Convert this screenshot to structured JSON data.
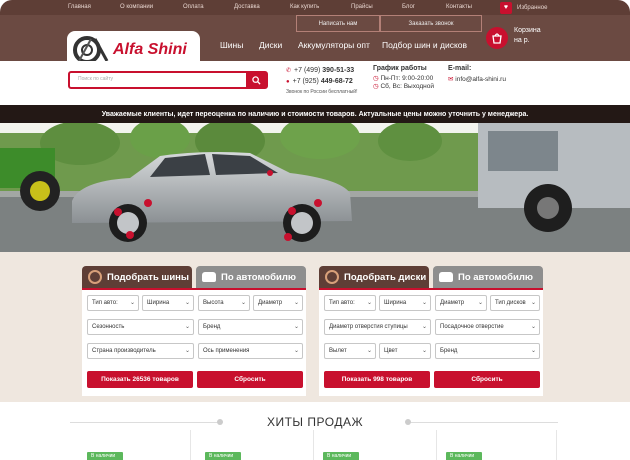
{
  "topnav": {
    "items": [
      "Главная",
      "О компании",
      "Оплата",
      "Доставка",
      "Как купить",
      "Прайсы",
      "Блог",
      "Контакты"
    ],
    "favorites": "Избранное"
  },
  "header": {
    "callback_label": "Написать нам",
    "order_call_label": "Заказать звонок",
    "logo_text": "Alfa Shini",
    "nav": [
      "Шины",
      "Диски",
      "Аккумуляторы опт",
      "Подбор шин и дисков"
    ],
    "cart_label": "Корзина",
    "cart_sub": "на р."
  },
  "search": {
    "placeholder": "Поиск по сайту"
  },
  "contacts": {
    "phone1_prefix": "+7 (499)",
    "phone1_number": "390-51-33",
    "phone2_prefix": "+7 (925)",
    "phone2_number": "449-68-72",
    "phones_note": "Звонок по России бесплатный!",
    "schedule_title": "График работы",
    "schedule_weekdays": "Пн-Пт: 9:00-20:00",
    "schedule_weekend": "Сб, Вс: Выходной",
    "email_title": "E-mail:",
    "email": "info@alfa-shini.ru"
  },
  "notice": "Уважаемые клиенты, идет переоценка по наличию и стоимости товаров. Актуальные цены можно уточнить у менеджера.",
  "tires_panel": {
    "tab_active": "Подобрать шины",
    "tab_inactive": "По автомобилю",
    "selects": [
      "Тип авто:",
      "Ширина",
      "Высота",
      "Диаметр",
      "Сезонность",
      "Бренд",
      "Страна производитель",
      "Ось применения"
    ],
    "show_button": "Показать 26536 товаров",
    "reset_button": "Сбросить"
  },
  "discs_panel": {
    "tab_active": "Подобрать диски",
    "tab_inactive": "По автомобилю",
    "selects": [
      "Тип авто:",
      "Ширина",
      "Диаметр",
      "Тип дисков",
      "Диаметр отверстия ступицы",
      "Посадочное отверстие",
      "Вылет",
      "Цвет",
      "Бренд"
    ],
    "show_button": "Показать 998 товаров",
    "reset_button": "Сбросить"
  },
  "hits": {
    "title": "ХИТЫ ПРОДАЖ",
    "badge": "В наличии"
  },
  "colors": {
    "accent": "#c8102e",
    "brown": "#6b4a42",
    "dark": "#231815"
  }
}
